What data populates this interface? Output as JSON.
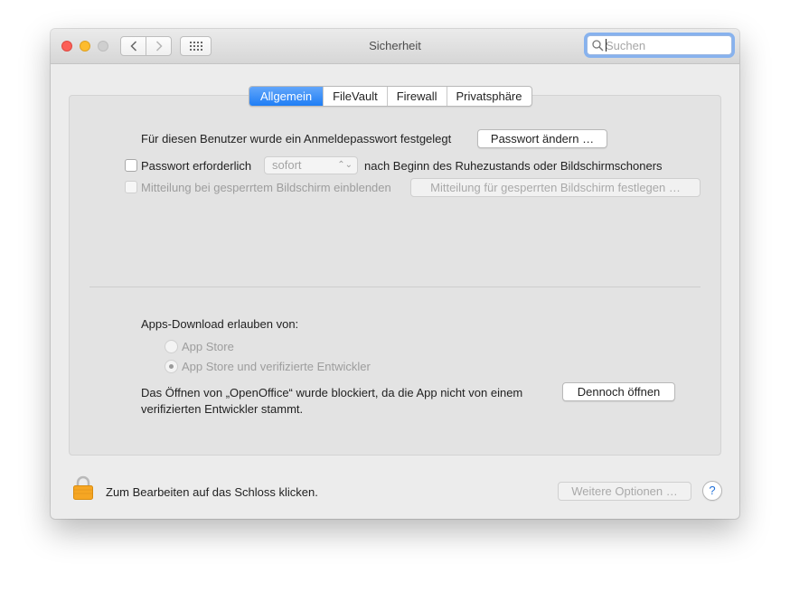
{
  "window": {
    "title": "Sicherheit"
  },
  "search": {
    "placeholder": "Suchen"
  },
  "tabs": [
    {
      "label": "Allgemein",
      "active": true
    },
    {
      "label": "FileVault"
    },
    {
      "label": "Firewall"
    },
    {
      "label": "Privatsphäre"
    }
  ],
  "general": {
    "password_text": "Für diesen Benutzer wurde ein Anmeldepasswort festgelegt",
    "change_password_label": "Passwort ändern …",
    "require_password_label": "Passwort erforderlich",
    "require_password_checked": false,
    "require_delay_value": "sofort",
    "require_suffix": "nach Beginn des Ruhezustands oder Bildschirmschoners",
    "lock_message_label": "Mitteilung bei gesperrtem Bildschirm einblenden",
    "lock_message_checked": false,
    "lock_message_button": "Mitteilung für gesperrten Bildschirm festlegen …"
  },
  "downloads": {
    "heading": "Apps-Download erlauben von:",
    "options": [
      {
        "label": "App Store",
        "selected": false
      },
      {
        "label": "App Store und verifizierte Entwickler",
        "selected": true
      }
    ],
    "blocked_line1": "Das Öffnen von „OpenOffice“ wurde blockiert, da die App nicht von einem",
    "blocked_line2": "verifizierten Entwickler stammt.",
    "open_anyway_label": "Dennoch öffnen"
  },
  "footer": {
    "lock_text": "Zum Bearbeiten auf das Schloss klicken.",
    "more_options_label": "Weitere Optionen …",
    "help_label": "?"
  },
  "icons": {
    "back": "chevron-left-icon",
    "forward": "chevron-right-icon",
    "grid": "grid-icon",
    "search": "search-icon",
    "lock": "lock-icon"
  },
  "colors": {
    "accent": "#1f7ef5",
    "close": "#fc5f57",
    "minimize": "#fdbc2e",
    "lock": "#f5a623"
  }
}
